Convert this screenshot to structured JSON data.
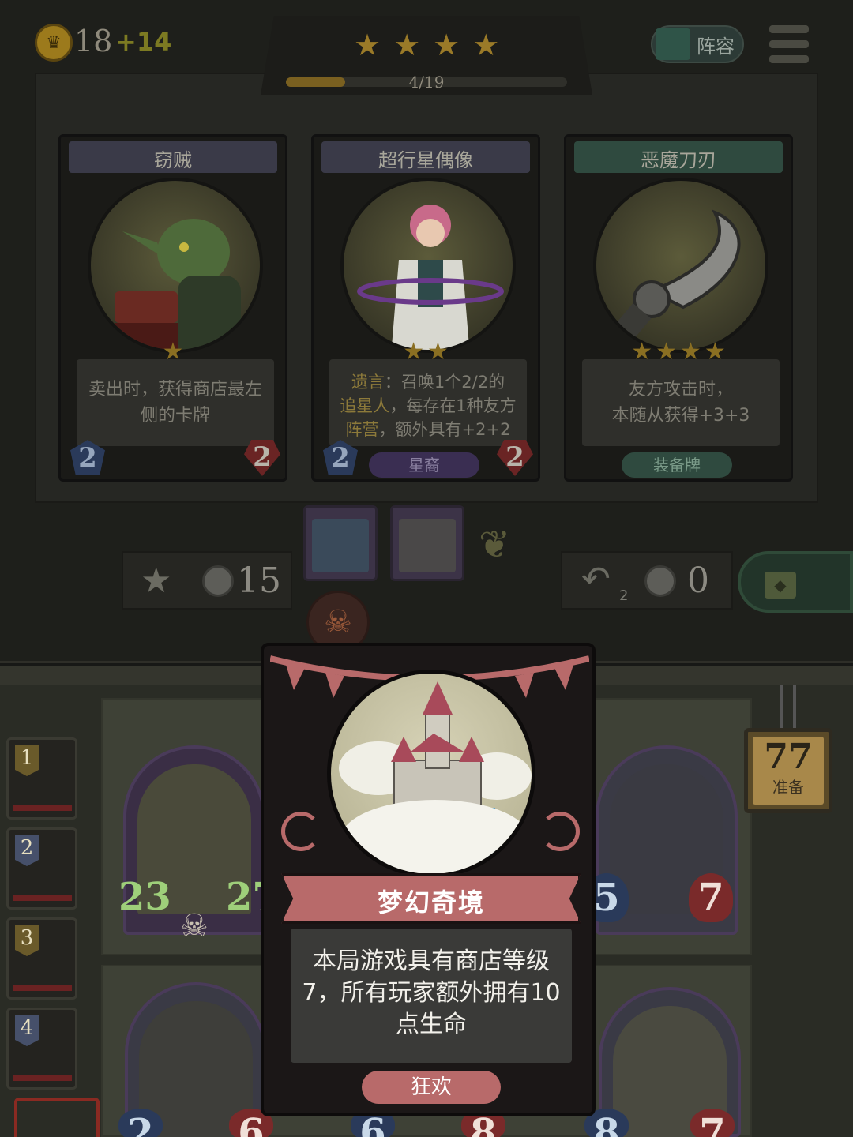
{
  "hud": {
    "gold": "18",
    "gold_income": "+14",
    "tier_progress_text": "4/19",
    "tier_progress_fraction": 0.21,
    "tier_star_count": 4,
    "lineup_label": "阵容",
    "coin_icon": "crown-coin-icon",
    "menu_icon": "hamburger-menu-icon"
  },
  "shop_cards": [
    {
      "name": "窃贼",
      "stars": 1,
      "desc_parts": [
        "卖出时，获得商店最左侧的卡牌"
      ],
      "attack": "2",
      "health": "2",
      "tag": "",
      "accent": "#3a3a48"
    },
    {
      "name": "超行星偶像",
      "stars": 2,
      "desc_hl1": "遗言",
      "desc_t1": "：召唤1个2/2的",
      "desc_hl2": "追星人",
      "desc_t2": "，每存在1种友方",
      "desc_hl3": "阵营",
      "desc_t3": "，额外具有+2+2",
      "attack": "2",
      "health": "2",
      "tag": "星裔",
      "accent": "#3a3a48"
    },
    {
      "name": "恶魔刀刃",
      "stars": 4,
      "desc_parts": [
        "友方攻击时，",
        "本随从获得+3+3"
      ],
      "tag": "装备牌",
      "accent": "#2f4a3f"
    }
  ],
  "controls": {
    "upgrade_cost": "15",
    "refresh_count": "2",
    "refresh_cost": "0",
    "upgrade_icon": "star-upgrade-icon",
    "refresh_icon": "refresh-arrow-icon",
    "lock_icon": "padlock-icon"
  },
  "hand": [
    {
      "num": "1"
    },
    {
      "num": "2"
    },
    {
      "num": "3"
    },
    {
      "num": "4"
    }
  ],
  "board": {
    "left_minion_attack": "23",
    "left_minion_health": "27",
    "right_minion_attack": "5",
    "right_minion_health": "7",
    "bottom_left_attack": "2",
    "bottom_left_health": "6",
    "bottom_mid_attack": "6",
    "bottom_mid_health": "8",
    "bottom_right_attack": "8",
    "bottom_right_health": "7",
    "deck_count": "77",
    "deck_label": "准备"
  },
  "popup": {
    "title": "梦幻奇境",
    "desc": "本局游戏具有商店等级7，所有玩家额外拥有10点生命",
    "tag": "狂欢",
    "accent": "#b86a6a"
  }
}
